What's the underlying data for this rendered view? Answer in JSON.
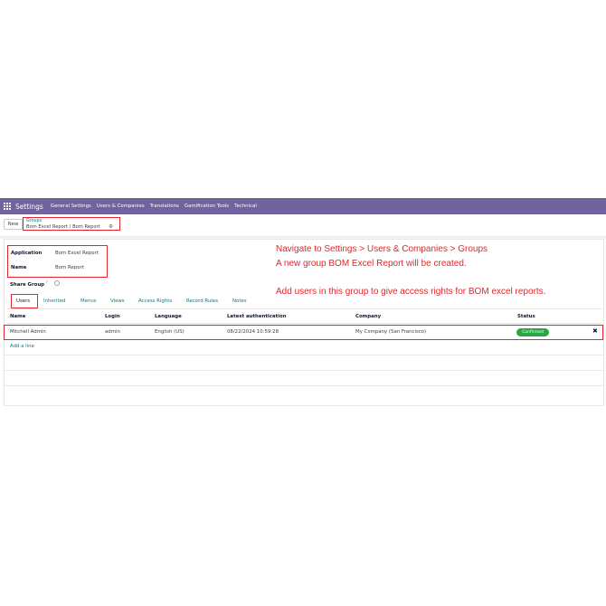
{
  "navbar": {
    "brand": "Settings",
    "items": [
      "General Settings",
      "Users & Companies",
      "Translations",
      "Gamification Tools",
      "Technical"
    ]
  },
  "control": {
    "new_label": "New",
    "breadcrumb_parent": "Groups",
    "breadcrumb_current": "Bom Excel Report / Bom Report",
    "gear_glyph": "⚙"
  },
  "form": {
    "application_label": "Application",
    "application_value": "Bom Excel Report",
    "name_label": "Name",
    "name_value": "Bom Report",
    "share_group_label": "Share Group",
    "share_group_help": "?",
    "share_group_checked": false
  },
  "annotations": [
    "Navigate to Settings > Users & Companies > Groups",
    "A new group BOM Excel Report will be created.",
    "Add users in this group to give access rights for BOM excel reports."
  ],
  "tabs": [
    "Users",
    "Inherited",
    "Menus",
    "Views",
    "Access Rights",
    "Record Rules",
    "Notes"
  ],
  "table": {
    "columns": [
      "Name",
      "Login",
      "Language",
      "Latest authentication",
      "Company",
      "Status"
    ],
    "rows": [
      {
        "name": "Mitchell Admin",
        "login": "admin",
        "language": "English (US)",
        "latest_auth": "08/22/2024 10:59:28",
        "company": "My Company (San Francisco)",
        "status": "Confirmed"
      }
    ],
    "add_line": "Add a line",
    "delete_glyph": "✖"
  },
  "colors": {
    "navbar": "#71639e",
    "accent": "#017e84",
    "annotation": "#e3262b",
    "status_badge": "#28a745"
  }
}
